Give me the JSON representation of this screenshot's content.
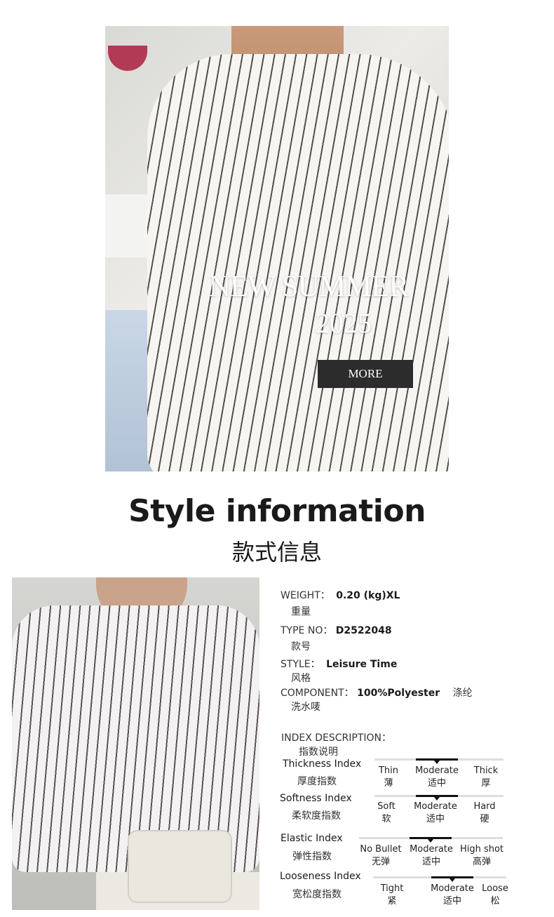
{
  "hero": {
    "title": "NEW SUMMER",
    "year": "2025",
    "more_label": "MORE"
  },
  "section": {
    "title": "Style information",
    "subtitle": "款式信息"
  },
  "specs": [
    {
      "label": "WEIGHT：",
      "value": "0.20 (kg)XL",
      "cn": "重量"
    },
    {
      "label": "TYPE NO：",
      "value": "D2522048",
      "cn": "款号"
    },
    {
      "label": "STYLE：",
      "value": "Leisure Time",
      "cn": "风格"
    },
    {
      "label": "COMPONENT：",
      "value": "100%Polyester",
      "extra": "涤纶",
      "cn": "洗水唛"
    }
  ],
  "index_description": {
    "label": "INDEX DESCRIPTION：",
    "cn": "指数说明"
  },
  "indexes": [
    {
      "name": "Thickness Index",
      "cn": "厚度指数",
      "options": [
        {
          "en": "Thin",
          "cn": "薄"
        },
        {
          "en": "Moderate",
          "cn": "适中"
        },
        {
          "en": "Thick",
          "cn": "厚"
        }
      ],
      "selected": 1
    },
    {
      "name": "Softness Index",
      "cn": "柔软度指数",
      "options": [
        {
          "en": "Soft",
          "cn": "软"
        },
        {
          "en": "Moderate",
          "cn": "适中"
        },
        {
          "en": "Hard",
          "cn": "硬"
        }
      ],
      "selected": 1
    },
    {
      "name": "Elastic Index",
      "cn": "弹性指数",
      "options": [
        {
          "en": "No Bullet",
          "cn": "无弹"
        },
        {
          "en": "Moderate",
          "cn": "适中"
        },
        {
          "en": "High shot",
          "cn": "高弹"
        }
      ],
      "selected": 1
    },
    {
      "name": "Looseness Index",
      "cn": "宽松度指数",
      "options": [
        {
          "en": "Tight",
          "cn": "紧"
        },
        {
          "en": "Moderate",
          "cn": "适中"
        },
        {
          "en": "Loose",
          "cn": "松"
        }
      ],
      "selected": 1
    }
  ]
}
